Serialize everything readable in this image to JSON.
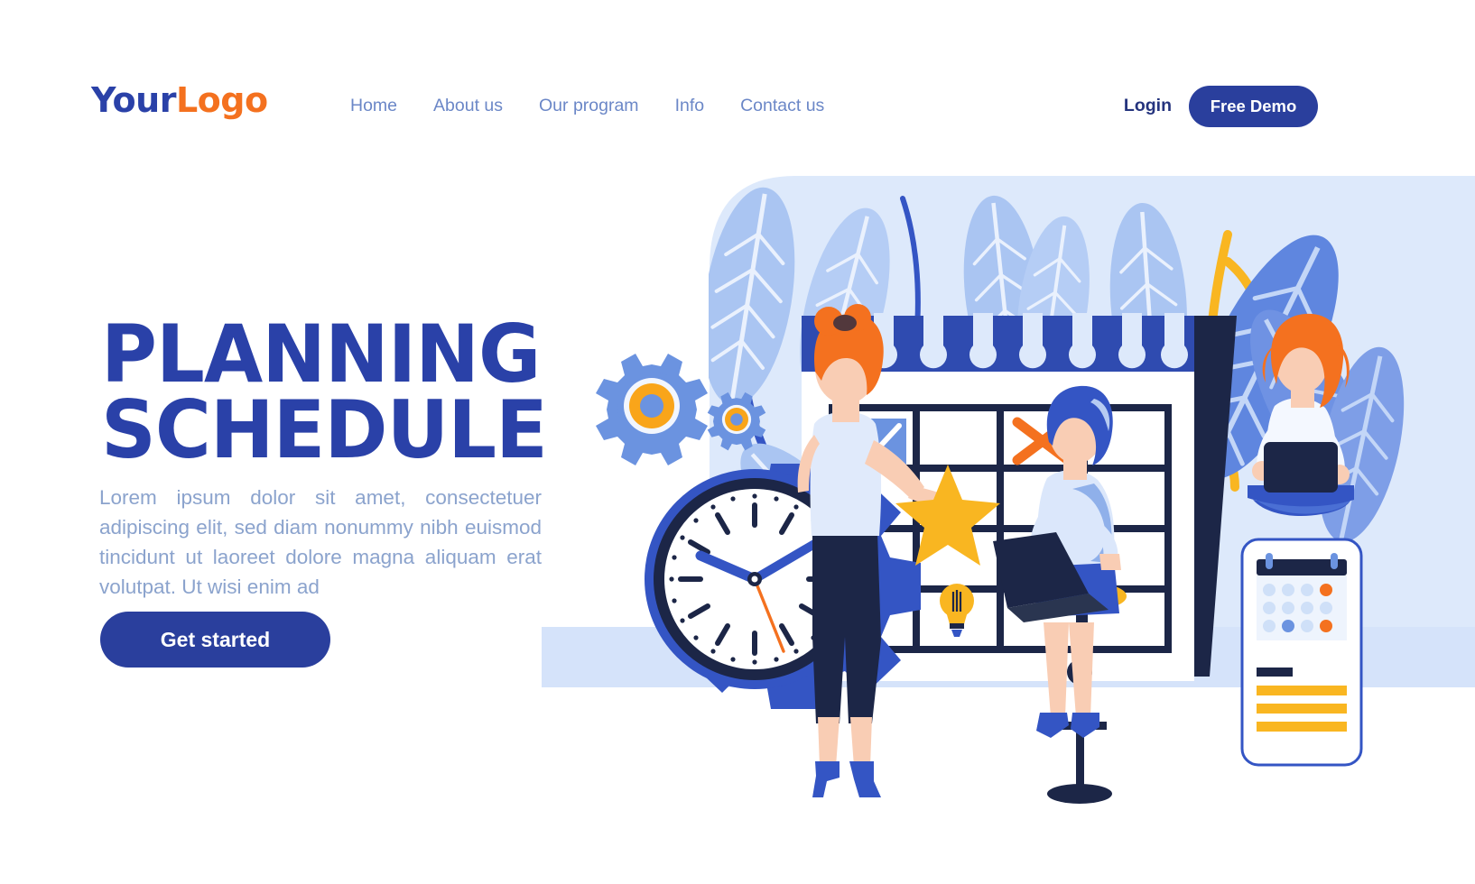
{
  "brand": {
    "logo_part1": "Your",
    "logo_part2": "Logo",
    "color_blue": "#2a41a8",
    "color_orange": "#f4711f"
  },
  "header": {
    "nav": [
      {
        "label": "Home"
      },
      {
        "label": "About us"
      },
      {
        "label": "Our program"
      },
      {
        "label": "Info"
      },
      {
        "label": "Contact us"
      }
    ],
    "login_label": "Login",
    "demo_label": "Free Demo"
  },
  "hero": {
    "title_line1": "PLANNING",
    "title_line2": "SCHEDULE",
    "paragraph": "Lorem ipsum dolor sit amet, consectetuer adipiscing elit, sed diam nonummy nibh euismod tincidunt ut laoreet dolore magna aliquam erat volutpat. Ut wisi enim ad",
    "cta_label": "Get started"
  },
  "illustration": {
    "scene_name": "planning-schedule-illustration",
    "elements": [
      "rounded-background-panel",
      "blue-leaf-plants",
      "yellow-branches",
      "wall-calendar",
      "calendar-spiral-binding",
      "calendar-grid",
      "chart-thumbnail-icon",
      "orange-x-mark-icon",
      "yellow-star-icon",
      "lightbulb-icon",
      "clock-in-gear",
      "small-gears",
      "standing-woman",
      "seated-woman-with-laptop",
      "woman-on-phone-with-laptop",
      "smartphone-calendar-app"
    ]
  },
  "palette": {
    "deep_blue": "#2a41a8",
    "royal_blue": "#3455c4",
    "mid_blue": "#4a6fd4",
    "light_blue": "#a8c3f0",
    "pale_blue": "#dce8fb",
    "panel_blue": "#dbe7fb",
    "navy": "#1c2647",
    "orange": "#f4711f",
    "yellow": "#f9b621",
    "skin": "#f9cdb4",
    "white": "#ffffff"
  }
}
